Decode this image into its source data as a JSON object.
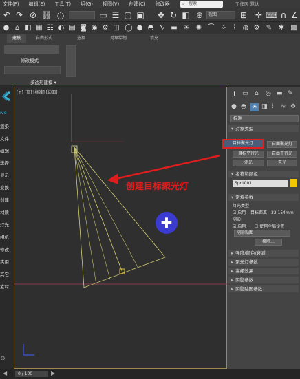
{
  "menu": {
    "items": [
      "文件(F)",
      "编辑(E)",
      "工具(T)",
      "组(G)",
      "视图(V)",
      "创建(C)",
      "修改器"
    ],
    "search_placeholder": "搜索",
    "workspace": "工作区 默认"
  },
  "toolbar1": {
    "viewdrop": "视图",
    "seldrop": ""
  },
  "ribbon": {
    "tabs": [
      "建模",
      "自由形式",
      "选择",
      "对象绘制",
      "填充"
    ],
    "mod_label": "修改模式",
    "poly_label": "多边形建模 ▾"
  },
  "left_panel": {
    "items": [
      "渲染",
      "文件",
      "编辑",
      "选择",
      "显示",
      "变换",
      "创建",
      "材质",
      "灯光",
      "相机",
      "修改",
      "实用",
      "其它",
      "素材"
    ]
  },
  "viewport": {
    "label": "[+] [顶] [标准] [边面]",
    "annotation": "创建目标聚光灯"
  },
  "command": {
    "dropdown": "标准",
    "object_type": "对象类型",
    "buttons": [
      "目标聚光灯",
      "自由聚光灯",
      "目标平行光",
      "自由平行光",
      "泛光",
      "天光"
    ],
    "name_color": "名称和颜色",
    "object_name": "Spot001",
    "general": "常规参数",
    "light_type": "灯光类型",
    "enable": "启用",
    "target_dist": "目标距离：32.154mm",
    "shadow": "阴影",
    "enable2": "启用",
    "global": "使用全局设置",
    "shadow_map": "阴影贴图",
    "exclude": "排除...",
    "sections": [
      "强度/颜色/衰减",
      "聚光灯参数",
      "高级效果",
      "阴影参数",
      "阴影贴图参数"
    ]
  },
  "status": {
    "frame": "0 / 100"
  },
  "colors": {
    "accent": "#e02020",
    "viewport_border": "#a08850",
    "light_cone": "#d4d070"
  }
}
